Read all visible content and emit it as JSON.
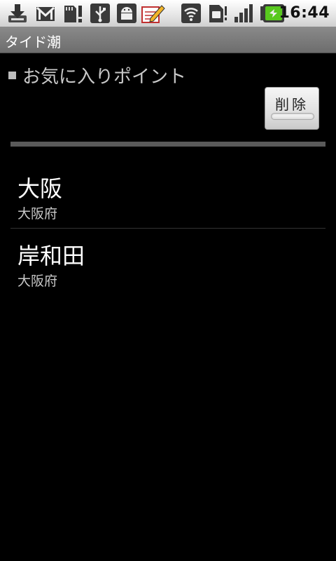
{
  "status_bar": {
    "time": "16:44",
    "icons": [
      "download-icon",
      "gmail-icon",
      "sd-card-alert-icon",
      "usb-icon",
      "android-debug-icon",
      "notepad-edit-icon",
      "wifi-icon",
      "sim-icon",
      "signal-icon",
      "battery-charging-icon"
    ]
  },
  "titlebar": {
    "title": "タイド潮"
  },
  "section": {
    "title": "お気に入りポイント",
    "delete_label": "削除"
  },
  "list": {
    "items": [
      {
        "name": "大阪",
        "prefecture": "大阪府"
      },
      {
        "name": "岸和田",
        "prefecture": "大阪府"
      }
    ]
  },
  "colors": {
    "background": "#000000",
    "titlebar": "#7a7a7a",
    "separator": "#5a5a5a"
  }
}
